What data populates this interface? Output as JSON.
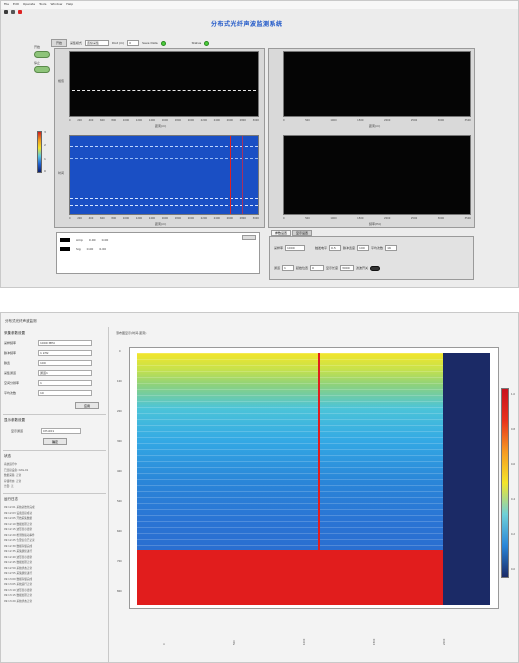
{
  "screenshot1": {
    "menu": [
      "File",
      "Edit",
      "Operate",
      "Tools",
      "Window",
      "Help"
    ],
    "app_title": "分布式光纤声波监测系统",
    "controls": {
      "start_label": "开始",
      "param1_label": "采集模式",
      "param1_value": "连续采集",
      "param2_label": "Dist (m)",
      "param2_value": "0",
      "param3_label": "Save Data",
      "param4_label": "Status"
    },
    "side_buttons": [
      {
        "label": "开始"
      },
      {
        "label": "停止"
      }
    ],
    "plot_top_left": {
      "ylabel": "幅值",
      "xlabel": "距离(m)",
      "xticks": [
        "0",
        "200",
        "400",
        "600",
        "800",
        "1000",
        "1200",
        "1400",
        "1600",
        "1800",
        "2000",
        "2200",
        "2400",
        "2600",
        "2800",
        "3000"
      ]
    },
    "plot_bottom_left": {
      "ylabel": "时间",
      "xlabel": "距离(m)",
      "xticks": [
        "0",
        "200",
        "400",
        "600",
        "800",
        "1000",
        "1200",
        "1400",
        "1600",
        "1800",
        "2000",
        "2200",
        "2400",
        "2600",
        "2800",
        "3000"
      ]
    },
    "plot_top_right": {
      "xlabel": "距离(m)",
      "xticks": [
        "0",
        "500",
        "1000",
        "1500",
        "2000",
        "2500",
        "3000",
        "3500"
      ]
    },
    "plot_bottom_right": {
      "xlabel": "频率(Hz)",
      "xticks": [
        "0",
        "500",
        "1000",
        "1500",
        "2000",
        "2500",
        "3000",
        "3500"
      ]
    },
    "colorbar_ticks": [
      "3",
      "2",
      "1",
      "0"
    ],
    "legend_rows": [
      {
        "name": "Amp",
        "v1": "0.00",
        "v2": "0.00"
      },
      {
        "name": "Sig",
        "v1": "0.00",
        "v2": "0.00"
      }
    ],
    "tabs": [
      "参数设置",
      "显示设置"
    ],
    "params": {
      "r1": [
        "采样率",
        "1000",
        "触发电平",
        "0.5",
        "脉冲宽度",
        "100",
        "平均次数",
        "16"
      ],
      "r2": [
        "通道",
        "1",
        "起始位置",
        "0",
        "显示长度",
        "3000",
        "滤波开关"
      ]
    },
    "colors": {
      "waterfall_bg": "#1a4fc4",
      "plot_bg": "#050505",
      "accent": "#1f57c8"
    }
  },
  "screenshot2": {
    "window_title": "分布式光纤声波监测",
    "section1": "采集参数设置",
    "rows": [
      {
        "label": "采样频率",
        "value": "1000 MHz"
      },
      {
        "label": "脉冲频率",
        "value": "1 kHz"
      },
      {
        "label": "脉宽",
        "value": "100"
      },
      {
        "label": "采集通道",
        "value": "通道1"
      },
      {
        "label": "空间分辨率",
        "value": "1"
      },
      {
        "label": "平均次数",
        "value": "10"
      }
    ],
    "apply_label": "应用",
    "section2": "显示参数设置",
    "display_row": {
      "label": "显示通道",
      "value": "CH-001"
    },
    "confirm_label": "确定",
    "section3": "状态",
    "status_lines": [
      "系统运行中",
      "已连接设备: DAS-01",
      "数据采集: 正常",
      "存储状态: 正常",
      "告警: 无"
    ],
    "section4": "运行日志",
    "log_lines": [
      "09:12:01 系统初始化完成",
      "09:12:03 设备连接成功",
      "09:12:05 开始采集数据",
      "09:12:10 数据处理正常",
      "09:12:15 波形显示更新",
      "09:12:20 检测到振动事件",
      "09:12:25 告警信息已记录",
      "09:12:30 数据存储完成",
      "09:12:35 采集继续进行",
      "09:12:40 波形显示更新",
      "09:12:45 数据处理正常",
      "09:12:50 系统状态正常",
      "09:12:55 采集继续进行",
      "09:13:00 数据存储完成",
      "09:13:05 系统运行正常",
      "09:13:10 波形显示更新",
      "09:13:15 数据处理正常",
      "09:13:20 系统状态正常"
    ],
    "plot_title": "瀑布图显示(时间-距离)",
    "yticks": [
      "0",
      "100",
      "200",
      "300",
      "400",
      "500",
      "600",
      "700",
      "800"
    ],
    "xticks": [
      "0",
      "500",
      "1000",
      "1500",
      "2000",
      "2500",
      "3000"
    ],
    "colorbar_ticks": [
      "1.0",
      "0.8",
      "0.6",
      "0.4",
      "0.2",
      "0.0"
    ],
    "colors": {
      "red": "#e11d1d",
      "navy": "#1b2a66",
      "yellow": "#f2e62a",
      "cyan": "#38c6e8",
      "blue": "#2a74d4"
    }
  }
}
